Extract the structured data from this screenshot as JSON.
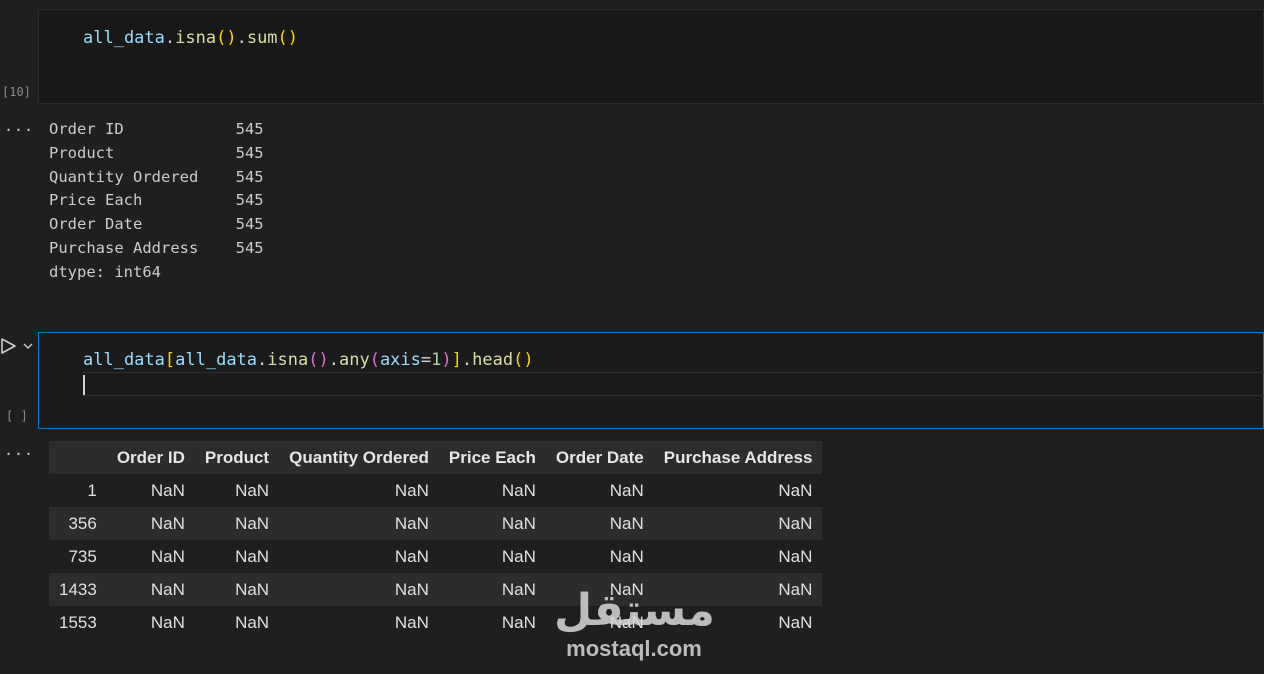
{
  "cell1": {
    "exec_count": "[10]",
    "code": {
      "var": "all_data",
      "dot1": ".",
      "fn1": "isna",
      "paren1": "()",
      "dot2": ".",
      "fn2": "sum",
      "paren2": "()"
    }
  },
  "output1": {
    "menu": "...",
    "rows": [
      {
        "name": "Order ID",
        "count": "545"
      },
      {
        "name": "Product",
        "count": "545"
      },
      {
        "name": "Quantity Ordered",
        "count": "545"
      },
      {
        "name": "Price Each",
        "count": "545"
      },
      {
        "name": "Order Date",
        "count": "545"
      },
      {
        "name": "Purchase Address",
        "count": "545"
      }
    ],
    "dtype": "dtype: int64"
  },
  "cell2": {
    "exec_count": "[ ]",
    "code": {
      "t1": "all_data",
      "t2": "[",
      "t3": "all_data",
      "t4": ".",
      "t5": "isna",
      "t6": "()",
      "t7": ".",
      "t8": "any",
      "t9": "(",
      "t10": "axis",
      "t11": "=",
      "t12": "1",
      "t13": ")",
      "t14": "]",
      "t15": ".",
      "t16": "head",
      "t17": "()"
    }
  },
  "output2": {
    "menu": "...",
    "columns": [
      "",
      "Order ID",
      "Product",
      "Quantity Ordered",
      "Price Each",
      "Order Date",
      "Purchase Address"
    ],
    "rows": [
      [
        "1",
        "NaN",
        "NaN",
        "NaN",
        "NaN",
        "NaN",
        "NaN"
      ],
      [
        "356",
        "NaN",
        "NaN",
        "NaN",
        "NaN",
        "NaN",
        "NaN"
      ],
      [
        "735",
        "NaN",
        "NaN",
        "NaN",
        "NaN",
        "NaN",
        "NaN"
      ],
      [
        "1433",
        "NaN",
        "NaN",
        "NaN",
        "NaN",
        "NaN",
        "NaN"
      ],
      [
        "1553",
        "NaN",
        "NaN",
        "NaN",
        "NaN",
        "NaN",
        "NaN"
      ]
    ]
  },
  "watermark": {
    "arabic": "مستقل",
    "latin": "mostaql.com"
  }
}
